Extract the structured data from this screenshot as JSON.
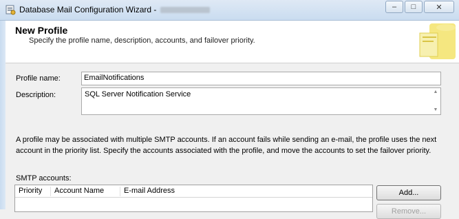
{
  "window": {
    "title": "Database Mail Configuration Wizard -",
    "minimize_glyph": "–",
    "maximize_glyph": "□",
    "close_glyph": "✕"
  },
  "header": {
    "title": "New Profile",
    "subtitle": "Specify the profile name, description, accounts, and failover priority."
  },
  "form": {
    "profile_name_label": "Profile name:",
    "profile_name_value": "EmailNotifications",
    "description_label": "Description:",
    "description_value": "SQL Server Notification Service"
  },
  "info_text": "A profile may be associated with multiple SMTP accounts. If an account fails while sending an e-mail, the profile uses the next account in the priority list. Specify the accounts associated with the profile, and move the accounts to set the failover priority.",
  "smtp": {
    "label": "SMTP accounts:",
    "columns": [
      "Priority",
      "Account Name",
      "E-mail Address"
    ],
    "add_button": "Add...",
    "remove_button": "Remove..."
  }
}
